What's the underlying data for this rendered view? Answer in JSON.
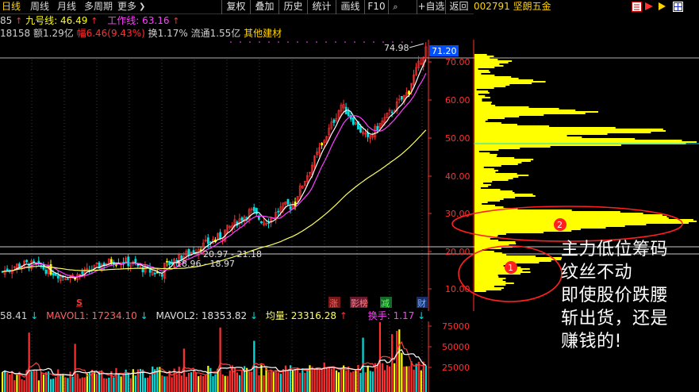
{
  "toolbar": {
    "periods": [
      "日线",
      "周线",
      "月线",
      "多周期",
      "更多"
    ],
    "more_arrow": "❯",
    "buttons": [
      "复权",
      "叠加",
      "历史",
      "统计",
      "画线",
      "F10",
      "+自选",
      "返回"
    ]
  },
  "right_header": {
    "code_name": "002791 坚朗五金"
  },
  "info_line1": {
    "prefix": "85",
    "indicator1_label": "九号线: 46.49",
    "indicator2_label": "工作线: 63.16",
    "up_arrow": "↑"
  },
  "info_line2": {
    "vol": "18158",
    "amount": "额1.29亿",
    "change": "幅6.46(9.43%)",
    "turnover": "换1.17%",
    "float": "流通1.55亿",
    "sector": "其他建材"
  },
  "main_chart": {
    "top_price_label": "74.98",
    "current_price_badge": "71.20",
    "y_axis_ticks": [
      "70.00",
      "60.00",
      "50.00",
      "40.00",
      "30.00",
      "20.00",
      "10.00"
    ],
    "low_marker1": "20.97 - 21.18",
    "low_marker2": "18.96 - 18.97",
    "markers": {
      "s_mark": "S",
      "zhang": "涨",
      "yingbang": "影榜",
      "jian": "减",
      "cai": "财"
    },
    "circle_labels": [
      "1",
      "2"
    ]
  },
  "volume_info": {
    "vol_value": "58.41",
    "mavol1": "MAVOL1: 17234.10",
    "mavol2": "MAVOL2: 18353.82",
    "junliang": "均量: 23316.28",
    "huanshou": "换手: 1.17",
    "down_arrow": "↓"
  },
  "volume_axis_ticks": [
    "75000",
    "50000",
    "25000"
  ],
  "overlay_text": [
    "主力低位筹码",
    "纹丝不动",
    "即使股价跌腰",
    "斩出货，还是",
    "赚钱的!"
  ],
  "colors": {
    "up": "#ff3030",
    "down": "#00e0e0",
    "yellow": "#ffff00",
    "magenta": "#ff40ff",
    "white": "#ffffff",
    "axis": "#ff3030"
  }
}
